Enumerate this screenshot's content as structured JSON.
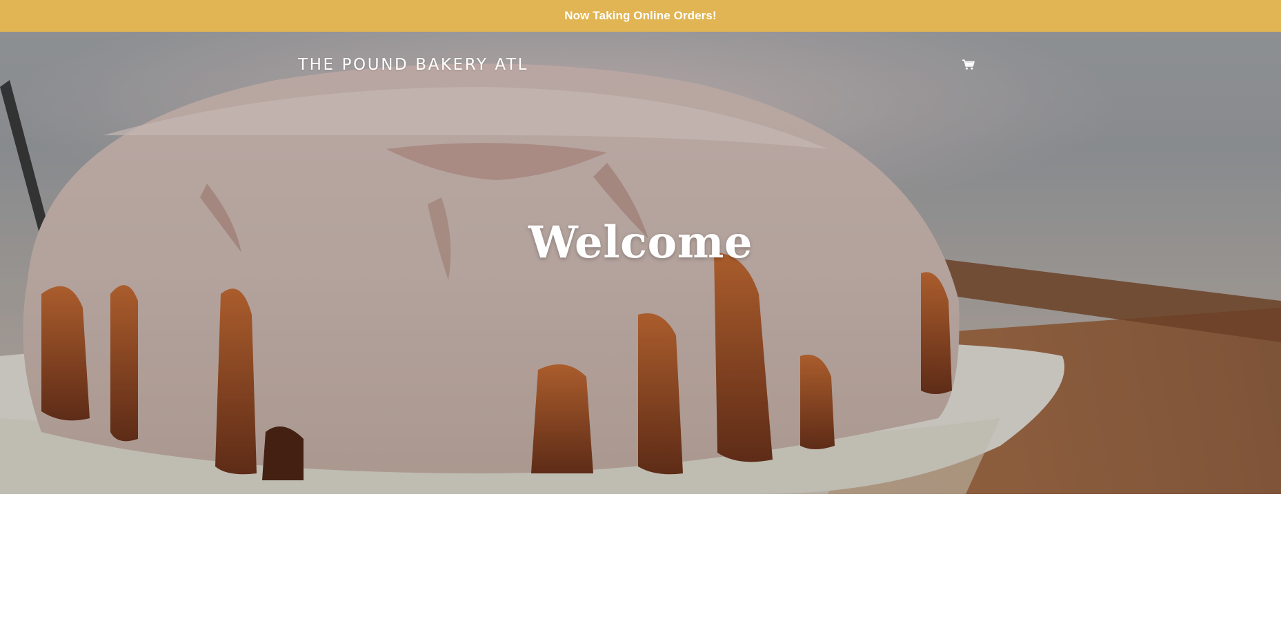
{
  "announcement": {
    "text": "Now Taking Online Orders!",
    "background_color": "#e1b553",
    "text_color": "#ffffff"
  },
  "header": {
    "logo_text": "THE POUND BAKERY ATL",
    "cart_icon": "shopping-cart-icon"
  },
  "hero": {
    "title": "Welcome",
    "image_subject": "glazed bundt pound cake on a plate"
  }
}
